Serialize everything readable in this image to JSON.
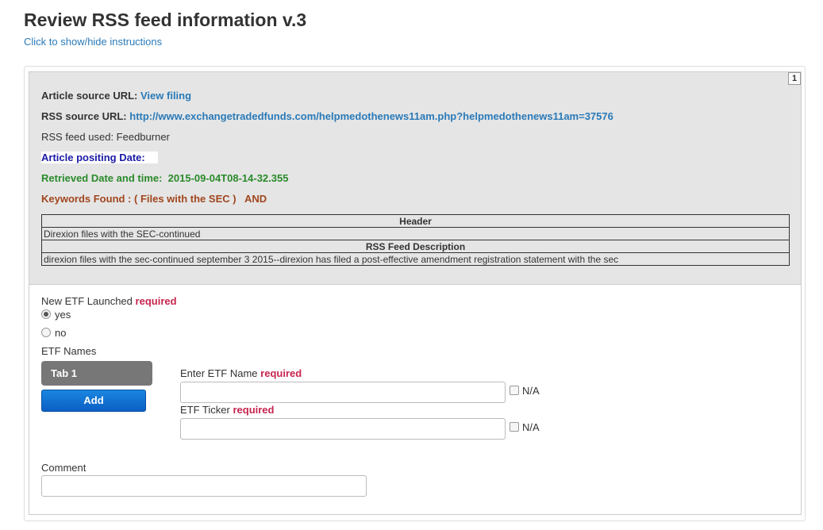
{
  "page": {
    "title": "Review RSS feed information v.3",
    "toggle_instructions": "Click to show/hide instructions"
  },
  "info": {
    "page_number": "1",
    "article_source_label": "Article source URL:",
    "article_source_link": "View filing",
    "rss_source_label": "RSS source URL:",
    "rss_source_link": "http://www.exchangetradedfunds.com/helpmedothenews11am.php?helpmedothenews11am=37576",
    "rss_feed_used": "RSS feed used: Feedburner",
    "article_date_label": "Article positing Date:",
    "retrieved_label": "Retrieved Date and time:",
    "retrieved_value": "2015-09-04T08-14-32.355",
    "keywords_label": "Keywords Found : ( Files with the SEC )",
    "keywords_op": "AND"
  },
  "feed_table": {
    "header_label": "Header",
    "header_value": "Direxion files with the SEC-continued",
    "description_label": "RSS Feed Description",
    "description_value": "direxion files with the sec-continued september 3 2015--direxion has filed a post-effective amendment registration statement with the sec"
  },
  "form": {
    "new_etf_label": "New ETF Launched",
    "required_text": "required",
    "option_yes": "yes",
    "option_no": "no",
    "etf_names_label": "ETF Names",
    "tab_label": "Tab 1",
    "add_label": "Add",
    "etf_name_label": "Enter ETF Name",
    "etf_name_value": "",
    "na_label": "N/A",
    "etf_ticker_label": "ETF Ticker",
    "etf_ticker_value": "",
    "comment_label": "Comment",
    "comment_value": ""
  }
}
